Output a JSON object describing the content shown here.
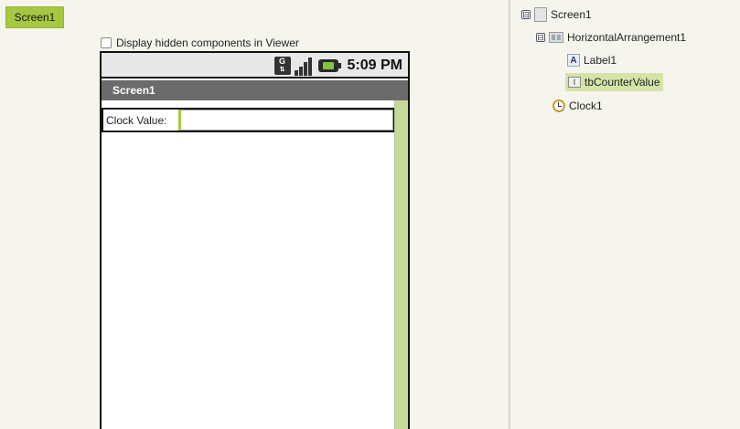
{
  "screen_tab": {
    "label": "Screen1"
  },
  "viewer": {
    "hidden_components_label": "Display hidden components in Viewer",
    "hidden_components_checked": false,
    "status_bar": {
      "time": "5:09 PM",
      "network_badge": "G"
    },
    "title": "Screen1",
    "label_text": "Clock Value:",
    "textbox_value": ""
  },
  "tree": {
    "nodes": [
      {
        "label": "Screen1",
        "icon": "screen-icon",
        "expanded": true
      },
      {
        "label": "HorizontalArrangement1",
        "icon": "horizontal-arrangement-icon",
        "expanded": true
      },
      {
        "label": "Label1",
        "icon": "label-icon"
      },
      {
        "label": "tbCounterValue",
        "icon": "textbox-icon",
        "selected": true
      },
      {
        "label": "Clock1",
        "icon": "clock-icon"
      }
    ],
    "collapse_glyph": "⊟"
  },
  "colors": {
    "accent": "#a5c840",
    "title_bar": "#6b6b6b",
    "selection": "#d6e3a8",
    "scroll_strip": "#c8d89a"
  }
}
